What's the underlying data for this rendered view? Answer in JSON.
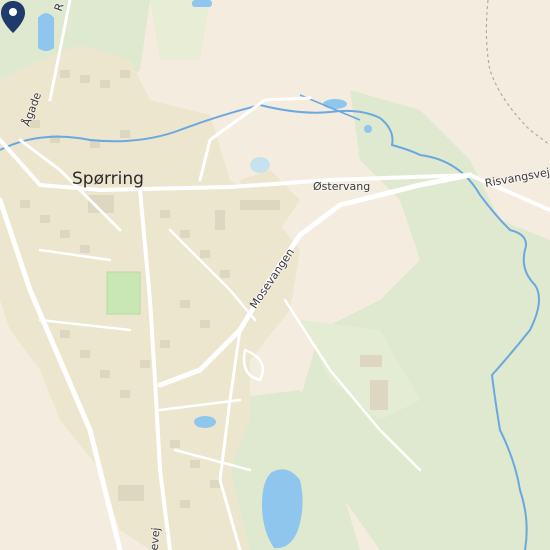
{
  "map": {
    "place_label": "Spørring",
    "road_labels": {
      "ostervang": "Østervang",
      "risvangsvej": "Risvangsvej",
      "mosevangen": "Mosevangen",
      "agade": "Ågade",
      "r_top": "R",
      "bottom_road": "devej"
    },
    "colors": {
      "background": "#f4ecdf",
      "green": "#dfe9cf",
      "urban": "#ece6cf",
      "water": "#8ec6ee",
      "stream": "#6aa8e0",
      "road": "#ffffff",
      "pin": "#1f3a6b"
    },
    "marker_icon": "map-pin-icon"
  }
}
